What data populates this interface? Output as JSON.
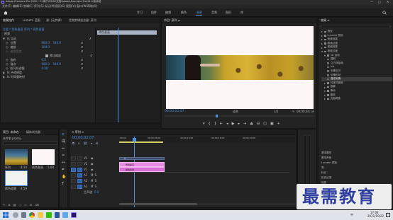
{
  "window": {
    "title": "Adobe Premiere Pro 2020 - C:\\用户\\PS\\Dl\\文档\\Adobe\\Premiere Pro\\14.0\\未命名",
    "buttons": [
      "—",
      "□",
      "✕"
    ]
  },
  "menu": [
    "文件(F)",
    "编辑(E)",
    "剪辑(C)",
    "序列(S)",
    "标记(M)",
    "图形(G)",
    "视图(V)",
    "窗口(W)",
    "帮助(H)"
  ],
  "workspaces": {
    "tabs": [
      "学习",
      "组件",
      "编辑",
      "颜色",
      "效果",
      "音频",
      "图形",
      "库"
    ],
    "active_index": 4
  },
  "effect_controls": {
    "tabs": [
      "效果控件",
      "Lumetri 范围",
      "源: (无剪辑)",
      "音频剪辑混合器: 序列"
    ],
    "breadcrumb": [
      "主要 * 两色垂直",
      "序列 * 两色垂直"
    ],
    "section_video": "视频",
    "clip_label": "两色垂直",
    "rows": [
      {
        "label": "fx 运动",
        "level": 0,
        "v1": "",
        "v2": ""
      },
      {
        "label": "位置",
        "level": 1,
        "v1": "960.0",
        "v2": "540.0"
      },
      {
        "label": "缩放",
        "level": 1,
        "v1": "100.0",
        "v2": ""
      },
      {
        "label": "缩放宽度",
        "level": 1,
        "v1": "",
        "v2": ""
      },
      {
        "label": "",
        "level": 1,
        "v1": "",
        "v2": "",
        "checkbox": "等比缩放"
      },
      {
        "label": "旋转",
        "level": 1,
        "v1": "0.0",
        "v2": ""
      },
      {
        "label": "锚点",
        "level": 1,
        "v1": "960.0",
        "v2": "540.0"
      },
      {
        "label": "防闪烁滤镜",
        "level": 1,
        "v1": "0.00",
        "v2": ""
      },
      {
        "label": "fx 不透明度",
        "level": 0,
        "v1": "",
        "v2": ""
      },
      {
        "label": "fx 时间重映射",
        "level": 0,
        "v1": "",
        "v2": ""
      }
    ]
  },
  "program_monitor": {
    "title": "节目: 序列 ≡",
    "timecode_left": "00;00;02;07",
    "zoom": "适合",
    "quality": "1/2",
    "timecode_right": "00;00;04;14"
  },
  "effects_panel": {
    "title": "效果 ≡",
    "items": [
      {
        "label": "预设",
        "level": 0,
        "open": false
      },
      {
        "label": "Lumetri 预设",
        "level": 0,
        "open": false
      },
      {
        "label": "音频效果",
        "level": 0,
        "open": false
      },
      {
        "label": "音频过渡",
        "level": 0,
        "open": false
      },
      {
        "label": "视频效果",
        "level": 0,
        "open": false
      },
      {
        "label": "视频过渡",
        "level": 0,
        "open": true
      },
      {
        "label": "3D 运动",
        "level": 1,
        "open": true
      },
      {
        "label": "翻转",
        "level": 2
      },
      {
        "label": "立方体旋转",
        "level": 2
      },
      {
        "label": "Iris",
        "level": 2
      },
      {
        "label": "划像交叉",
        "level": 2
      },
      {
        "label": "划像形状",
        "level": 2
      },
      {
        "label": "盒形划像",
        "level": 2,
        "selected": true
      },
      {
        "label": "沉浸式视频",
        "level": 1,
        "open": false
      },
      {
        "label": "溶解",
        "level": 1,
        "open": false
      },
      {
        "label": "滑动",
        "level": 1,
        "open": false
      },
      {
        "label": "缩放",
        "level": 1,
        "open": false
      },
      {
        "label": "页面剥落",
        "level": 1,
        "open": false
      }
    ],
    "extra": [
      "基本图形",
      "基本声音",
      "Lumetri 颜色",
      "库",
      "标记",
      "历史记录",
      "信息"
    ]
  },
  "project_panel": {
    "tabs": [
      "项目: 未命名",
      "媒体浏览器"
    ],
    "path": "未命名.prproj",
    "items": [
      {
        "label": "序列",
        "duration": "4;14"
      },
      {
        "label": "两色垂直",
        "duration": "5;00"
      },
      {
        "label": "颜色遮罩",
        "duration": "4;59"
      }
    ]
  },
  "timeline": {
    "title": "× 序列 ≡",
    "timecode": "00;00;02;07",
    "ruler": [
      ":00;00",
      "00;00;05;00",
      "00;00;10;00",
      "00;00;15;00",
      "00;00;20;00"
    ],
    "tracks_v": [
      "V3",
      "V2",
      "V1"
    ],
    "tracks_a": [
      "A1",
      "A2",
      "A3"
    ],
    "master": "主声道",
    "master_value": "0.0",
    "clips": {
      "v2": "两色垂直",
      "v1": "颜色遮罩"
    }
  },
  "taskbar": {
    "time": "17:04",
    "date": "2021/10/22",
    "ime": "中"
  },
  "watermark": {
    "text": "最需教育"
  }
}
